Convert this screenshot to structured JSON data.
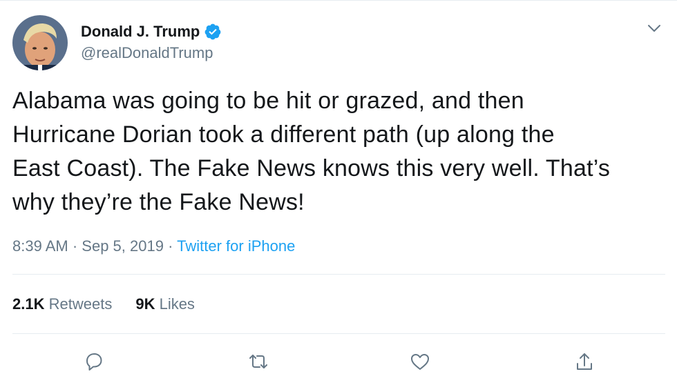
{
  "author": {
    "display_name": "Donald J. Trump",
    "handle": "@realDonaldTrump",
    "verified": true
  },
  "tweet": {
    "lines": [
      "Alabama was going to be hit or grazed, and then",
      "Hurricane Dorian took a different path (up along the",
      "East Coast). The Fake News knows this very well. That’s",
      "why they’re the Fake News!"
    ],
    "time": "8:39 AM",
    "separator": "·",
    "date": "Sep 5, 2019",
    "source": "Twitter for iPhone"
  },
  "stats": {
    "retweets_count": "2.1K",
    "retweets_label": "Retweets",
    "likes_count": "9K",
    "likes_label": "Likes"
  },
  "actions": [
    {
      "name": "reply",
      "icon": "reply-icon"
    },
    {
      "name": "retweet",
      "icon": "retweet-icon"
    },
    {
      "name": "like",
      "icon": "heart-icon"
    },
    {
      "name": "share",
      "icon": "share-icon"
    }
  ],
  "colors": {
    "text": "#14171a",
    "secondary": "#657786",
    "link": "#1da1f2",
    "verified_badge": "#1da1f2",
    "divider": "#e6ecf0"
  }
}
